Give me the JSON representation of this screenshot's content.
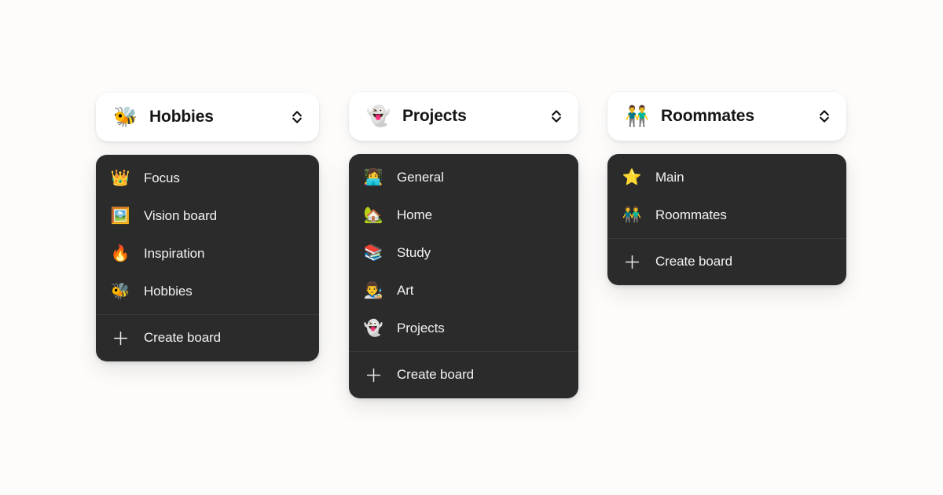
{
  "background_color": "#fdfcfb",
  "panel_color": "#2b2b2b",
  "header_color": "#ffffff",
  "text_color_dark": "#151515",
  "text_color_light": "#f2f2f2",
  "icons": {
    "selector": "chevron-up-down-icon",
    "create": "plus-icon"
  },
  "columns": [
    {
      "id": "hobbies",
      "header": {
        "emoji": "🐝",
        "emoji_name": "honeybee",
        "title": "Hobbies"
      },
      "items": [
        {
          "emoji": "👑",
          "emoji_name": "crown",
          "label": "Focus"
        },
        {
          "emoji": "🖼️",
          "emoji_name": "framed-picture",
          "label": "Vision board"
        },
        {
          "emoji": "🔥",
          "emoji_name": "fire",
          "label": "Inspiration"
        },
        {
          "emoji": "🐝",
          "emoji_name": "honeybee",
          "label": "Hobbies"
        }
      ],
      "create_label": "Create board"
    },
    {
      "id": "projects",
      "header": {
        "emoji": "👻",
        "emoji_name": "ghost",
        "title": "Projects"
      },
      "items": [
        {
          "emoji": "👩‍💻",
          "emoji_name": "technologist",
          "label": "General"
        },
        {
          "emoji": "🏡",
          "emoji_name": "house-with-garden",
          "label": "Home"
        },
        {
          "emoji": "📚",
          "emoji_name": "books",
          "label": "Study"
        },
        {
          "emoji": "👨‍🎨",
          "emoji_name": "artist",
          "label": "Art"
        },
        {
          "emoji": "👻",
          "emoji_name": "ghost",
          "label": "Projects"
        }
      ],
      "create_label": "Create board"
    },
    {
      "id": "roommates",
      "header": {
        "emoji": "👬",
        "emoji_name": "two-men-holding-hands",
        "title": "Roommates"
      },
      "items": [
        {
          "emoji": "⭐",
          "emoji_name": "star",
          "label": "Main"
        },
        {
          "emoji": "👬",
          "emoji_name": "two-men-holding-hands",
          "label": "Roommates"
        }
      ],
      "create_label": "Create board"
    }
  ]
}
